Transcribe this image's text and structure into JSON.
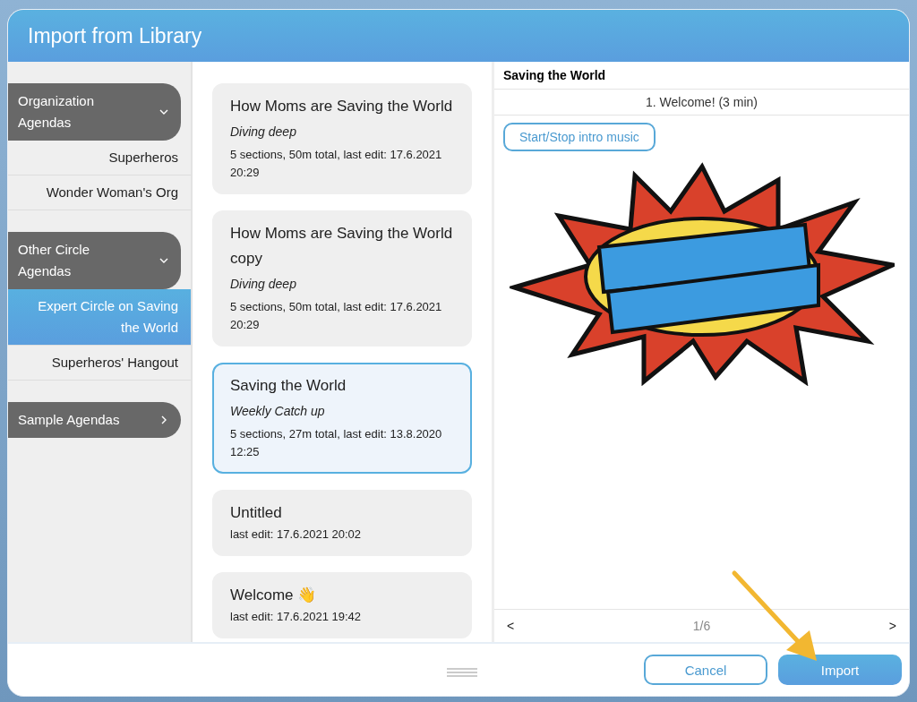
{
  "window": {
    "title": "Import from Library"
  },
  "sidebar": {
    "groups": [
      {
        "label": "Organization Agendas",
        "expanded": true,
        "items": [
          {
            "label": "Superheros",
            "selected": false
          },
          {
            "label": "Wonder Woman's Org",
            "selected": false
          }
        ]
      },
      {
        "label": "Other Circle Agendas",
        "expanded": true,
        "items": [
          {
            "label": "Expert Circle on Saving the World",
            "selected": true
          },
          {
            "label": "Superheros' Hangout",
            "selected": false
          }
        ]
      },
      {
        "label": "Sample Agendas",
        "expanded": false
      }
    ]
  },
  "agendas": [
    {
      "title": "How Moms are Saving the World",
      "subtitle": "Diving deep",
      "details": "5 sections, 50m total, last edit: 17.6.2021 20:29",
      "selected": false
    },
    {
      "title": "How Moms are Saving the World copy",
      "subtitle": "Diving deep",
      "details": "5 sections, 50m total, last edit: 17.6.2021 20:29",
      "selected": false
    },
    {
      "title": "Saving the World",
      "subtitle": "Weekly Catch up",
      "details": "5 sections, 27m total, last edit: 13.8.2020 12:25",
      "selected": true
    },
    {
      "title": "Untitled",
      "details": "last edit: 17.6.2021 20:02",
      "selected": false
    },
    {
      "title": "Welcome 👋",
      "details": "last edit: 17.6.2021 19:42",
      "selected": false
    }
  ],
  "preview": {
    "title": "Saving the World",
    "section": "1. Welcome! (3 min)",
    "button": "Start/Stop intro music",
    "prev": "<",
    "page": "1/6",
    "next": ">"
  },
  "buttons": {
    "cancel": "Cancel",
    "import": "Import"
  }
}
